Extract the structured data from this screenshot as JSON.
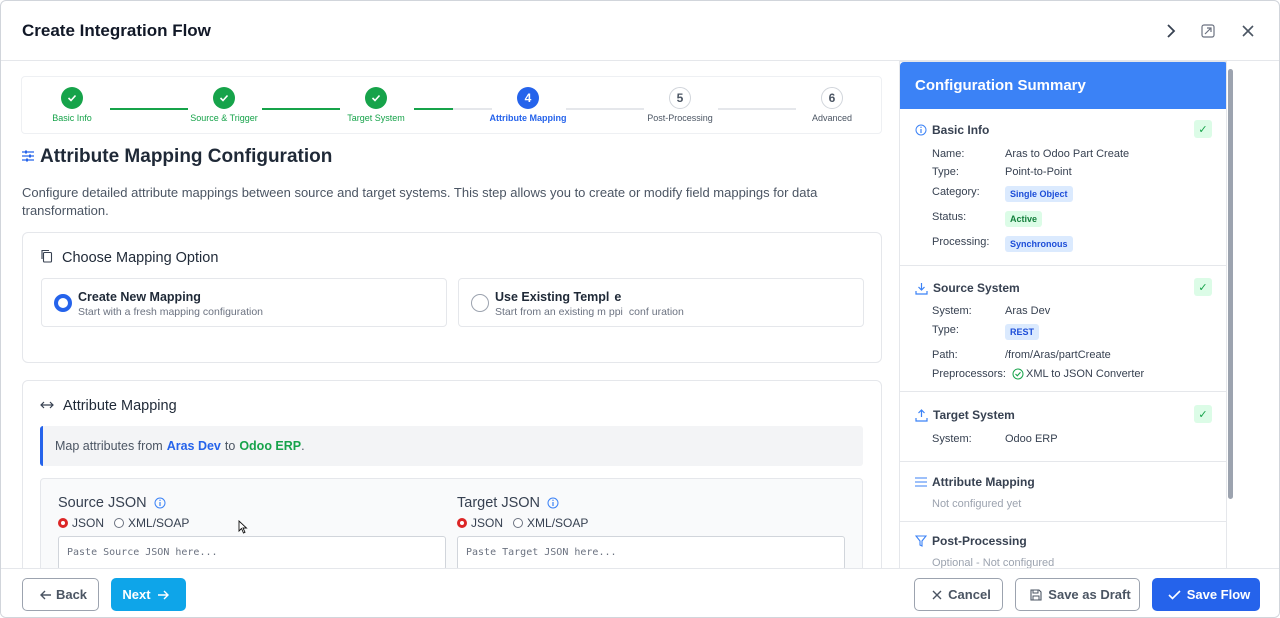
{
  "header": {
    "title": "Create Integration Flow"
  },
  "stepper": {
    "steps": [
      {
        "num": "1",
        "label": "Basic Info"
      },
      {
        "num": "2",
        "label": "Source & Trigger"
      },
      {
        "num": "3",
        "label": "Target System"
      },
      {
        "num": "4",
        "label": "Attribute Mapping"
      },
      {
        "num": "5",
        "label": "Post-Processing"
      },
      {
        "num": "6",
        "label": "Advanced"
      }
    ]
  },
  "section": {
    "title": "Attribute Mapping Configuration",
    "description": "Configure detailed attribute mappings between source and target systems. This step allows you to create or modify field mappings for data transformation."
  },
  "choose": {
    "title": "Choose Mapping Option",
    "new_title": "Create New Mapping",
    "new_desc": "Start with a fresh mapping configuration",
    "existing_title": "Use Existing Templ",
    "existing_title_tail": "e",
    "existing_desc_a": "Start from an existing m",
    "existing_desc_b": "ppi",
    "existing_desc_c": "conf",
    "existing_desc_d": "uration"
  },
  "mapping": {
    "title": "Attribute Mapping",
    "info_prefix": "Map attributes from",
    "source_name": "Aras Dev",
    "info_mid": "to",
    "target_name": "Odoo ERP",
    "info_suffix": ".",
    "source_json_title": "Source JSON",
    "target_json_title": "Target JSON",
    "opt_json": "JSON",
    "opt_xml": "XML/SOAP",
    "source_placeholder": "Paste Source JSON here...",
    "target_placeholder": "Paste Target JSON here..."
  },
  "summary": {
    "title": "Configuration Summary",
    "basic": {
      "title": "Basic Info",
      "name_k": "Name:",
      "name_v": "Aras to Odoo Part Create",
      "type_k": "Type:",
      "type_v": "Point-to-Point",
      "category_k": "Category:",
      "category_v": "Single Object",
      "status_k": "Status:",
      "status_v": "Active",
      "processing_k": "Processing:",
      "processing_v": "Synchronous"
    },
    "source": {
      "title": "Source System",
      "system_k": "System:",
      "system_v": "Aras Dev",
      "type_k": "Type:",
      "type_v": "REST",
      "path_k": "Path:",
      "path_v": "/from/Aras/partCreate",
      "pre_k": "Preprocessors:",
      "pre_v": "XML to JSON Converter"
    },
    "target": {
      "title": "Target System",
      "system_k": "System:",
      "system_v": "Odoo ERP"
    },
    "attr": {
      "title": "Attribute Mapping",
      "note": "Not configured yet"
    },
    "post": {
      "title": "Post-Processing",
      "note": "Optional - Not configured"
    }
  },
  "footer": {
    "back": "Back",
    "next": "Next",
    "cancel": "Cancel",
    "draft": "Save as Draft",
    "save": "Save Flow"
  },
  "colors": {
    "primary": "#2563eb",
    "success": "#16a34a",
    "accent": "#0ea5e9",
    "summary_header": "#3b82f6"
  }
}
